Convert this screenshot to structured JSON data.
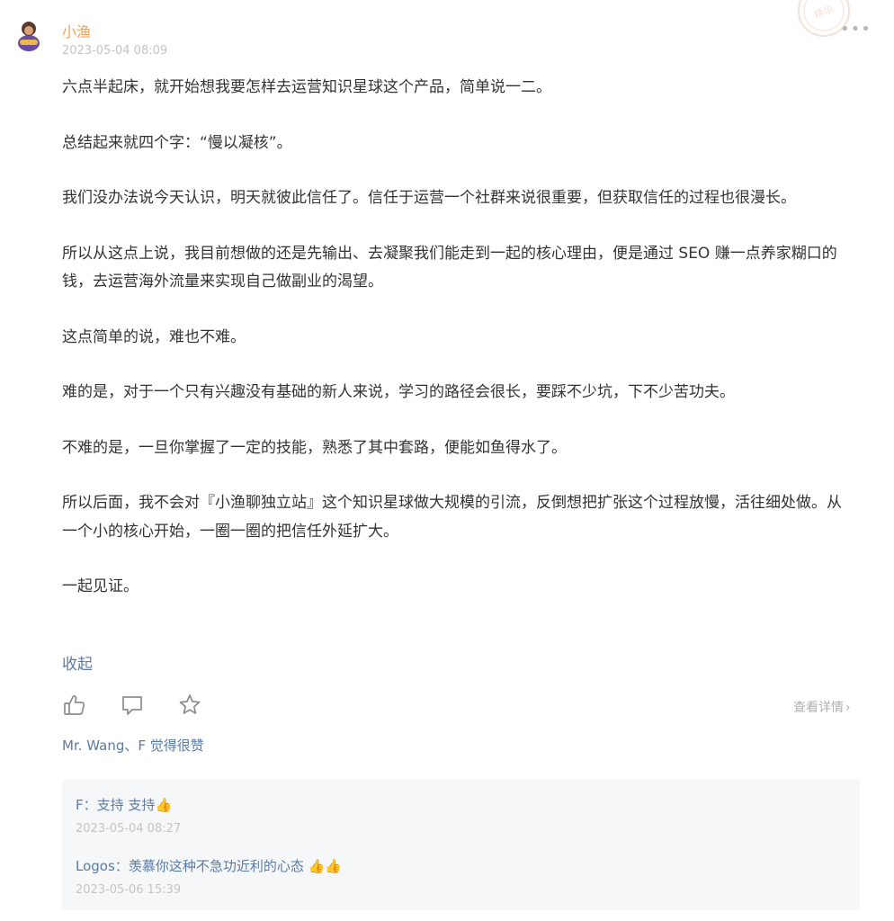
{
  "post": {
    "author": "小渔",
    "date": "2023-05-04 08:09",
    "stamp_text": "精华",
    "paragraphs": [
      "六点半起床，就开始想我要怎样去运营知识星球这个产品，简单说一二。",
      "总结起来就四个字：“慢以凝核”。",
      "我们没办法说今天认识，明天就彼此信任了。信任于运营一个社群来说很重要，但获取信任的过程也很漫长。",
      "所以从这点上说，我目前想做的还是先输出、去凝聚我们能走到一起的核心理由，便是通过 SEO 赚一点养家糊口的钱，去运营海外流量来实现自己做副业的渴望。",
      "这点简单的说，难也不难。",
      "难的是，对于一个只有兴趣没有基础的新人来说，学习的路径会很长，要踩不少坑，下不少苦功夫。",
      "不难的是，一旦你掌握了一定的技能，熟悉了其中套路，便能如鱼得水了。",
      "所以后面，我不会对『小渔聊独立站』这个知识星球做大规模的引流，反倒想把扩张这个过程放慢，活往细处做。从一个小的核心开始，一圈一圈的把信任外延扩大。",
      "一起见证。"
    ],
    "collapse_label": "收起",
    "detail_label": "查看详情",
    "likes_text": "Mr. Wang、F 觉得很赞"
  },
  "comments": [
    {
      "author": "F",
      "sep": "：",
      "text": "支持 支持",
      "emoji": "👍",
      "date": "2023-05-04 08:27"
    },
    {
      "author": "Logos",
      "sep": "：",
      "text": "羡慕你这种不急功近利的心态 ",
      "emoji": "👍👍",
      "date": "2023-05-06 15:39"
    }
  ],
  "colors": {
    "author": "#f5a259",
    "link": "#5b7ba3",
    "muted": "#c4c4c4",
    "comment_bg": "#f6f7f9"
  }
}
